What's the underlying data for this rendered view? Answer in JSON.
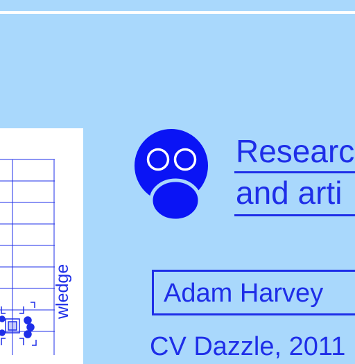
{
  "heading": {
    "line1": "Researc",
    "line2": "and arti"
  },
  "author": "Adam Harvey",
  "work": "CV Dazzle, 2011",
  "side_card": {
    "rotated_text": "wledge"
  },
  "colors": {
    "background": "#a9d8fc",
    "accent": "#1e2ee8",
    "card": "#ffffff"
  },
  "icons": [
    "gas-mask-icon",
    "circuit-chip-icon"
  ]
}
